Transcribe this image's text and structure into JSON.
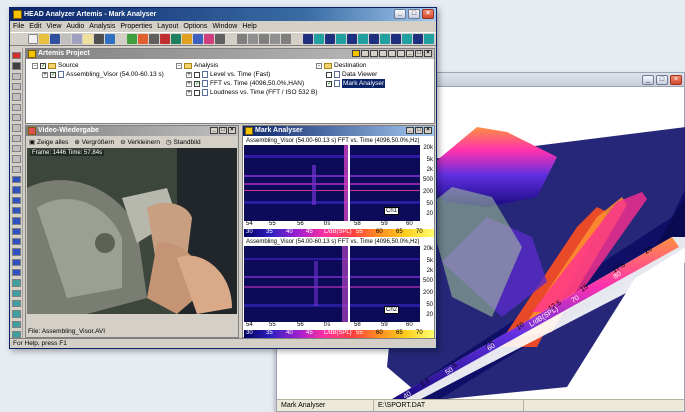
{
  "main_window": {
    "title": "HEAD Analyzer Artemis - Mark Analyser",
    "menu": [
      "File",
      "Edit",
      "View",
      "Audio",
      "Analysis",
      "Properties",
      "Layout",
      "Options",
      "Window",
      "Help"
    ],
    "statusbar": "For Help, press F1"
  },
  "project_panel": {
    "title": "Artemis Project",
    "source": {
      "label": "Source",
      "items": [
        "Assembling_Visor (54.00-60.13 s)"
      ]
    },
    "analysis": {
      "label": "Analysis",
      "items": [
        "Level vs. Time (Fast)",
        "FFT vs. Time (4096,50.0%,HAN)",
        "Loudness vs. Time (FFT / ISO 532 B)"
      ]
    },
    "destination": {
      "label": "Destination",
      "items": [
        "Data Viewer",
        "Mark Analyser"
      ]
    }
  },
  "video_panel": {
    "title": "Video-Wiedergabe",
    "buttons": [
      "Zeige alles",
      "Vergrößern",
      "Verkleinern",
      "Standbild"
    ],
    "frame_info": "Frame: 1446 Time: 57.84s",
    "file": "File: Assembling_Visor.AVI"
  },
  "mark_panel": {
    "title": "Mark Analyser",
    "spectrograms": [
      {
        "header": "Assembling_Visor (54.00-60.13 s) FFT vs. Time (4096,50.0%,Hz)",
        "channel": "Ch1",
        "yticks": [
          "20k",
          "10k",
          "5k",
          "2k",
          "1k",
          "500",
          "200",
          "100",
          "50",
          "20"
        ],
        "xticks": [
          "54",
          "55",
          "56",
          "t/s",
          "58",
          "59",
          "60"
        ],
        "colorbar": [
          "30",
          "35",
          "40",
          "45",
          "L/dB(SPL)",
          "55",
          "60",
          "65",
          "70"
        ]
      },
      {
        "header": "Assembling_Visor (54.00-60.13 s) FFT vs. Time (4096,50.0%,Hz)",
        "channel": "Ch2",
        "yticks": [
          "20k",
          "10k",
          "5k",
          "2k",
          "1k",
          "500",
          "200",
          "100",
          "50",
          "20"
        ],
        "xticks": [
          "54",
          "55",
          "56",
          "t/s",
          "58",
          "59",
          "60"
        ],
        "colorbar": [
          "30",
          "35",
          "40",
          "45",
          "L/dB(SPL)",
          "55",
          "60",
          "65",
          "70"
        ]
      }
    ]
  },
  "bg_window": {
    "status_left": "Mark Analyser",
    "status_right": "E:\\SPORT.DAT",
    "axis_time": [
      "2.5",
      "5",
      "7.5",
      "10",
      "12.5",
      "15",
      "17.5",
      "20"
    ],
    "axis_level": [
      "40",
      "50",
      "60",
      "L/dB(SPL)",
      "70",
      "80"
    ]
  }
}
